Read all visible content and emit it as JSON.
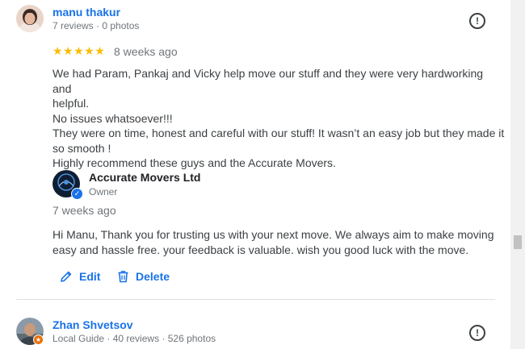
{
  "review1": {
    "name": "manu thakur",
    "meta": "7 reviews · 0 photos",
    "rating": 5,
    "stars": "★★★★★",
    "time": "8 weeks ago",
    "text_lines": [
      "We had Param, Pankaj and Vicky help move our stuff and they were very hardworking and",
      "helpful.",
      "No issues whatsoever!!!",
      "They were on time, honest and careful with our stuff! It wasn’t an easy job but they made it",
      "so smooth !",
      "Highly recommend these guys and the Accurate Movers."
    ],
    "flag_icon": "report-flag-icon"
  },
  "owner_reply": {
    "name": "Accurate Movers Ltd",
    "role": "Owner",
    "time": "7 weeks ago",
    "text_lines": [
      "Hi Manu, Thank you for trusting us with your next move. We always aim to make moving",
      "easy and hassle free. your feedback is valuable. wish you good luck with the move."
    ],
    "verified_icon": "verified-check-icon"
  },
  "actions": {
    "edit_label": "Edit",
    "delete_label": "Delete",
    "edit_icon": "pencil-icon",
    "delete_icon": "trash-icon"
  },
  "review2": {
    "name": "Zhan Shvetsov",
    "meta": "Local Guide · 40 reviews · 526 photos",
    "flag_icon": "report-flag-icon"
  },
  "colors": {
    "link_blue": "#1a73e8",
    "star_yellow": "#fbbc04",
    "text": "#3c4043",
    "muted": "#70757a",
    "local_guide_orange": "#e8710a"
  }
}
